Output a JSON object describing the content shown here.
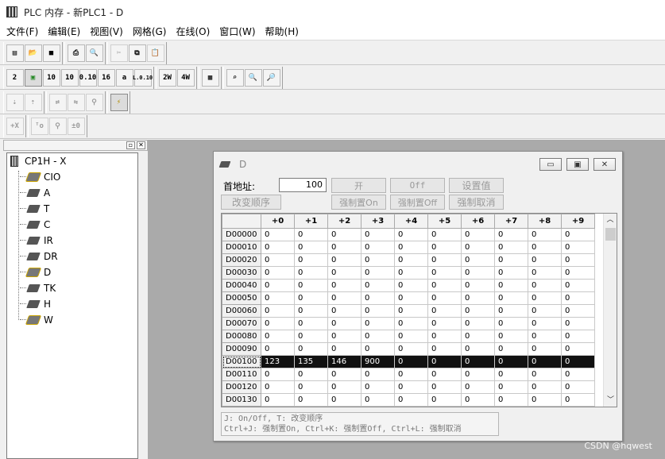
{
  "window": {
    "title": "PLC 内存 - 新PLC1 - D"
  },
  "menu": [
    "文件(F)",
    "编辑(E)",
    "视图(V)",
    "网格(G)",
    "在线(O)",
    "窗口(W)",
    "帮助(H)"
  ],
  "toolbar2_labels": [
    "2",
    "",
    "10",
    "10",
    "0.10",
    "16",
    "a",
    "L.0.10",
    "2W",
    "4W",
    "",
    "",
    "",
    ""
  ],
  "tree": {
    "root": "CP1H - X",
    "items": [
      "CIO",
      "A",
      "T",
      "C",
      "IR",
      "DR",
      "D",
      "TK",
      "H",
      "W"
    ]
  },
  "child": {
    "title": "D",
    "address_label": "首地址:",
    "address_value": "100",
    "buttons": {
      "on": "开",
      "off": "Off",
      "set_value": "设置值",
      "change_order": "改变顺序",
      "force_on": "强制置On",
      "force_off": "强制置Off",
      "force_cancel": "强制取消"
    },
    "columns": [
      "+0",
      "+1",
      "+2",
      "+3",
      "+4",
      "+5",
      "+6",
      "+7",
      "+8",
      "+9"
    ],
    "rows": [
      {
        "addr": "D00000",
        "v": [
          "0",
          "0",
          "0",
          "0",
          "0",
          "0",
          "0",
          "0",
          "0",
          "0"
        ]
      },
      {
        "addr": "D00010",
        "v": [
          "0",
          "0",
          "0",
          "0",
          "0",
          "0",
          "0",
          "0",
          "0",
          "0"
        ]
      },
      {
        "addr": "D00020",
        "v": [
          "0",
          "0",
          "0",
          "0",
          "0",
          "0",
          "0",
          "0",
          "0",
          "0"
        ]
      },
      {
        "addr": "D00030",
        "v": [
          "0",
          "0",
          "0",
          "0",
          "0",
          "0",
          "0",
          "0",
          "0",
          "0"
        ]
      },
      {
        "addr": "D00040",
        "v": [
          "0",
          "0",
          "0",
          "0",
          "0",
          "0",
          "0",
          "0",
          "0",
          "0"
        ]
      },
      {
        "addr": "D00050",
        "v": [
          "0",
          "0",
          "0",
          "0",
          "0",
          "0",
          "0",
          "0",
          "0",
          "0"
        ]
      },
      {
        "addr": "D00060",
        "v": [
          "0",
          "0",
          "0",
          "0",
          "0",
          "0",
          "0",
          "0",
          "0",
          "0"
        ]
      },
      {
        "addr": "D00070",
        "v": [
          "0",
          "0",
          "0",
          "0",
          "0",
          "0",
          "0",
          "0",
          "0",
          "0"
        ]
      },
      {
        "addr": "D00080",
        "v": [
          "0",
          "0",
          "0",
          "0",
          "0",
          "0",
          "0",
          "0",
          "0",
          "0"
        ]
      },
      {
        "addr": "D00090",
        "v": [
          "0",
          "0",
          "0",
          "0",
          "0",
          "0",
          "0",
          "0",
          "0",
          "0"
        ]
      },
      {
        "addr": "D00100",
        "v": [
          "123",
          "135",
          "146",
          "900",
          "0",
          "0",
          "0",
          "0",
          "0",
          "0"
        ],
        "selected": true
      },
      {
        "addr": "D00110",
        "v": [
          "0",
          "0",
          "0",
          "0",
          "0",
          "0",
          "0",
          "0",
          "0",
          "0"
        ]
      },
      {
        "addr": "D00120",
        "v": [
          "0",
          "0",
          "0",
          "0",
          "0",
          "0",
          "0",
          "0",
          "0",
          "0"
        ]
      },
      {
        "addr": "D00130",
        "v": [
          "0",
          "0",
          "0",
          "0",
          "0",
          "0",
          "0",
          "0",
          "0",
          "0"
        ]
      }
    ],
    "hint_line1": "J: On/Off,   T: 改变顺序",
    "hint_line2": " Ctrl+J: 强制置On,  Ctrl+K:  强制置Off,  Ctrl+L: 强制取消"
  },
  "watermark": "CSDN @hqwest"
}
